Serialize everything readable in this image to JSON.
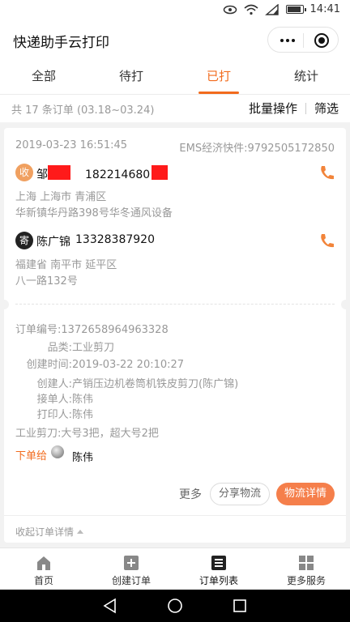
{
  "status_bar": {
    "time": "14:41",
    "icons": [
      "eye-icon",
      "wifi-icon",
      "signal-icon",
      "battery-icon"
    ]
  },
  "header": {
    "title": "快递助手云打印",
    "menu_icon": "more-dots-icon",
    "close_icon": "target-icon"
  },
  "tabs": [
    {
      "label": "全部",
      "active": false
    },
    {
      "label": "待打",
      "active": false
    },
    {
      "label": "已打",
      "active": true
    },
    {
      "label": "统计",
      "active": false
    }
  ],
  "summary": {
    "text": "共 17 条订单 (03.18~03.24)",
    "batch_label": "批量操作",
    "filter_label": "筛选"
  },
  "order": {
    "datetime": "2019-03-23 16:51:45",
    "carrier": "EMS经济快件:9792505172850",
    "receiver": {
      "badge": "收",
      "name": "邹",
      "phone": "182214680",
      "address_line1": "上海 上海市 青浦区",
      "address_line2": "华新镇华丹路398号华冬通风设备"
    },
    "sender": {
      "badge": "寄",
      "name": "陈广锦",
      "phone": "13328387920",
      "address_line1": "福建省 南平市 延平区",
      "address_line2": "八一路132号"
    },
    "details": [
      {
        "label": "订单编号:",
        "value": "1372658964963328"
      },
      {
        "label": "品类:",
        "value": "工业剪刀"
      },
      {
        "label": "创建时间:",
        "value": "2019-03-22 20:10:27"
      },
      {
        "label": "创建人:",
        "value": "产销压边机卷筒机铁皮剪刀(陈广锦)"
      },
      {
        "label": "接单人:",
        "value": "陈伟"
      },
      {
        "label": "打印人:",
        "value": "陈伟"
      }
    ],
    "note": "工业剪刀:大号3把，超大号2把",
    "assign_label": "下单给",
    "assignee": "陈伟",
    "more_label": "更多",
    "share_label": "分享物流",
    "detail_label": "物流详情",
    "collapse_label": "收起订单详情",
    "accent_color": "#f26b1d"
  },
  "bottom_nav": [
    {
      "label": "首页",
      "icon": "home-icon"
    },
    {
      "label": "创建订单",
      "icon": "add-order-icon"
    },
    {
      "label": "订单列表",
      "icon": "order-list-icon",
      "active": true
    },
    {
      "label": "更多服务",
      "icon": "grid-icon"
    }
  ],
  "system_nav": [
    "back-icon",
    "home-circle-icon",
    "recent-apps-icon"
  ]
}
